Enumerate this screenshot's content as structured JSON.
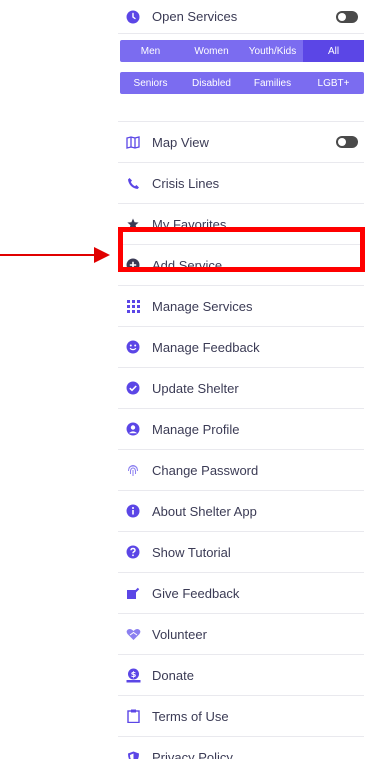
{
  "colors": {
    "accent": "#5b46e6",
    "filter_bg": "#7b6cf0",
    "highlight": "#ff0000",
    "text": "#3b3b55"
  },
  "menu": {
    "open_services": "Open Services",
    "filters_row1": [
      "Men",
      "Women",
      "Youth/Kids",
      "All"
    ],
    "filters_row2": [
      "Seniors",
      "Disabled",
      "Families",
      "LGBT+"
    ],
    "active_filter": "All",
    "items": [
      {
        "label": "Map View",
        "icon": "map-icon"
      },
      {
        "label": "Crisis Lines",
        "icon": "phone-icon"
      },
      {
        "label": "My Favorites",
        "icon": "star-icon"
      },
      {
        "label": "Add Service",
        "icon": "plus-circle-icon"
      },
      {
        "label": "Manage Services",
        "icon": "grid-icon"
      },
      {
        "label": "Manage Feedback",
        "icon": "smile-icon"
      },
      {
        "label": "Update Shelter",
        "icon": "check-circle-icon"
      },
      {
        "label": "Manage Profile",
        "icon": "user-circle-icon"
      },
      {
        "label": "Change Password",
        "icon": "fingerprint-icon"
      },
      {
        "label": "About Shelter App",
        "icon": "info-icon"
      },
      {
        "label": "Show Tutorial",
        "icon": "question-icon"
      },
      {
        "label": "Give Feedback",
        "icon": "edit-icon"
      },
      {
        "label": "Volunteer",
        "icon": "heart-hands-icon"
      },
      {
        "label": "Donate",
        "icon": "donate-icon"
      },
      {
        "label": "Terms of Use",
        "icon": "clipboard-icon"
      },
      {
        "label": "Privacy Policy",
        "icon": "shield-icon"
      }
    ]
  }
}
